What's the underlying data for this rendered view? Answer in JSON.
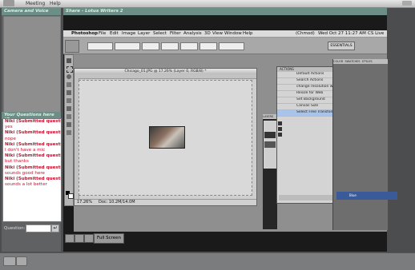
{
  "menubar": {
    "items": [
      "Meeting",
      "Help"
    ]
  },
  "left": {
    "camera_header": "Camera and Voice",
    "questions_header": "Your Questions here (Q",
    "chat": [
      {
        "kind": "q",
        "text": "Niki (Submitted question):"
      },
      {
        "kind": "a",
        "text": "yes"
      },
      {
        "kind": "q",
        "text": "Niki (Submitted question):"
      },
      {
        "kind": "a",
        "text": "nope"
      },
      {
        "kind": "q",
        "text": "Niki (Submitted question):"
      },
      {
        "kind": "a",
        "text": "I don't have a mic"
      },
      {
        "kind": "q",
        "text": "Niki (Submitted question):"
      },
      {
        "kind": "a",
        "text": "but thanks"
      },
      {
        "kind": "q",
        "text": "Niki (Submitted question):"
      },
      {
        "kind": "a",
        "text": "sounds good here"
      },
      {
        "kind": "q",
        "text": "Niki (Submitted question):"
      },
      {
        "kind": "a",
        "text": "sounds a lot better"
      }
    ],
    "question_label": "Question:"
  },
  "share": {
    "title": "Share - Lotus Writers 2"
  },
  "ps": {
    "menu": [
      "Photoshop",
      "File",
      "Edit",
      "Image",
      "Layer",
      "Select",
      "Filter",
      "Analysis",
      "3D",
      "View",
      "Window",
      "Help"
    ],
    "clock": "Wed Oct 27 11:27 AM",
    "owner": "(Chmod)",
    "user": "CS Live",
    "essentials": "ESSENTIALS",
    "doc_title": "Chicago_01.JPG @ 17.26% (Layer 0, RGB/8) *",
    "zoom": "17.26%",
    "doc_info": "Doc: 10.2M/14.0M"
  },
  "actions": {
    "tab": "ACTIONS",
    "rows": [
      "Default Actions",
      "Search Actions",
      "change resolution web to CMYK",
      "Resize for Web",
      "Set Background",
      "Canvas Size",
      "Select Free Transform, move, Gain"
    ]
  },
  "right": {
    "tabs": [
      "COLOR",
      "SWATCHES",
      "STYLES"
    ],
    "layer_label": "Blue"
  },
  "layers": {
    "tab": "LAYERS"
  },
  "bottom": {
    "fullscreen": "Full Screen"
  }
}
